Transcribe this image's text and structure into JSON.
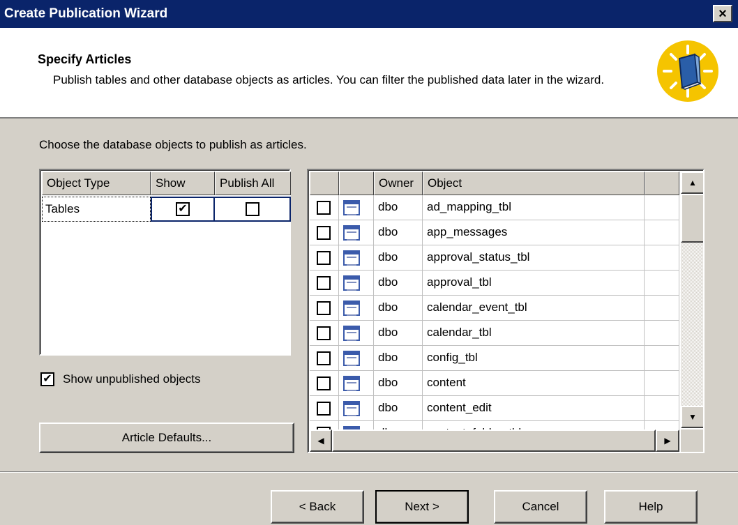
{
  "window": {
    "title": "Create Publication Wizard",
    "close_label": "×"
  },
  "header": {
    "title": "Specify Articles",
    "description": "Publish tables and other database objects as articles. You can filter the published data later in the wizard."
  },
  "instruction": "Choose the database objects to publish as articles.",
  "object_types": {
    "columns": [
      "Object Type",
      "Show",
      "Publish All"
    ],
    "rows": [
      {
        "type": "Tables",
        "show": "✔",
        "publish_all": ""
      }
    ]
  },
  "show_unpublished": {
    "label": "Show unpublished objects",
    "mark": "✔"
  },
  "buttons": {
    "article_defaults": "Article Defaults...",
    "back": "< Back",
    "next": "Next >",
    "cancel": "Cancel",
    "help": "Help"
  },
  "articles": {
    "columns": [
      "",
      "",
      "Owner",
      "Object",
      ""
    ],
    "rows": [
      {
        "owner": "dbo",
        "object": "ad_mapping_tbl"
      },
      {
        "owner": "dbo",
        "object": "app_messages"
      },
      {
        "owner": "dbo",
        "object": "approval_status_tbl"
      },
      {
        "owner": "dbo",
        "object": "approval_tbl"
      },
      {
        "owner": "dbo",
        "object": "calendar_event_tbl"
      },
      {
        "owner": "dbo",
        "object": "calendar_tbl"
      },
      {
        "owner": "dbo",
        "object": "config_tbl"
      },
      {
        "owner": "dbo",
        "object": "content"
      },
      {
        "owner": "dbo",
        "object": "content_edit"
      },
      {
        "owner": "dbo",
        "object": "content_folder_tbl"
      }
    ]
  },
  "scrollbar": {
    "up": "▲",
    "down": "▼",
    "left": "◀",
    "right": "▶"
  },
  "icons": {
    "header": "book-light-icon",
    "row": "table-icon"
  },
  "colors": {
    "titlebar": "#0a246a",
    "face": "#d4d0c8",
    "selection": "#0a246a",
    "icon_yellow": "#f5c400"
  }
}
